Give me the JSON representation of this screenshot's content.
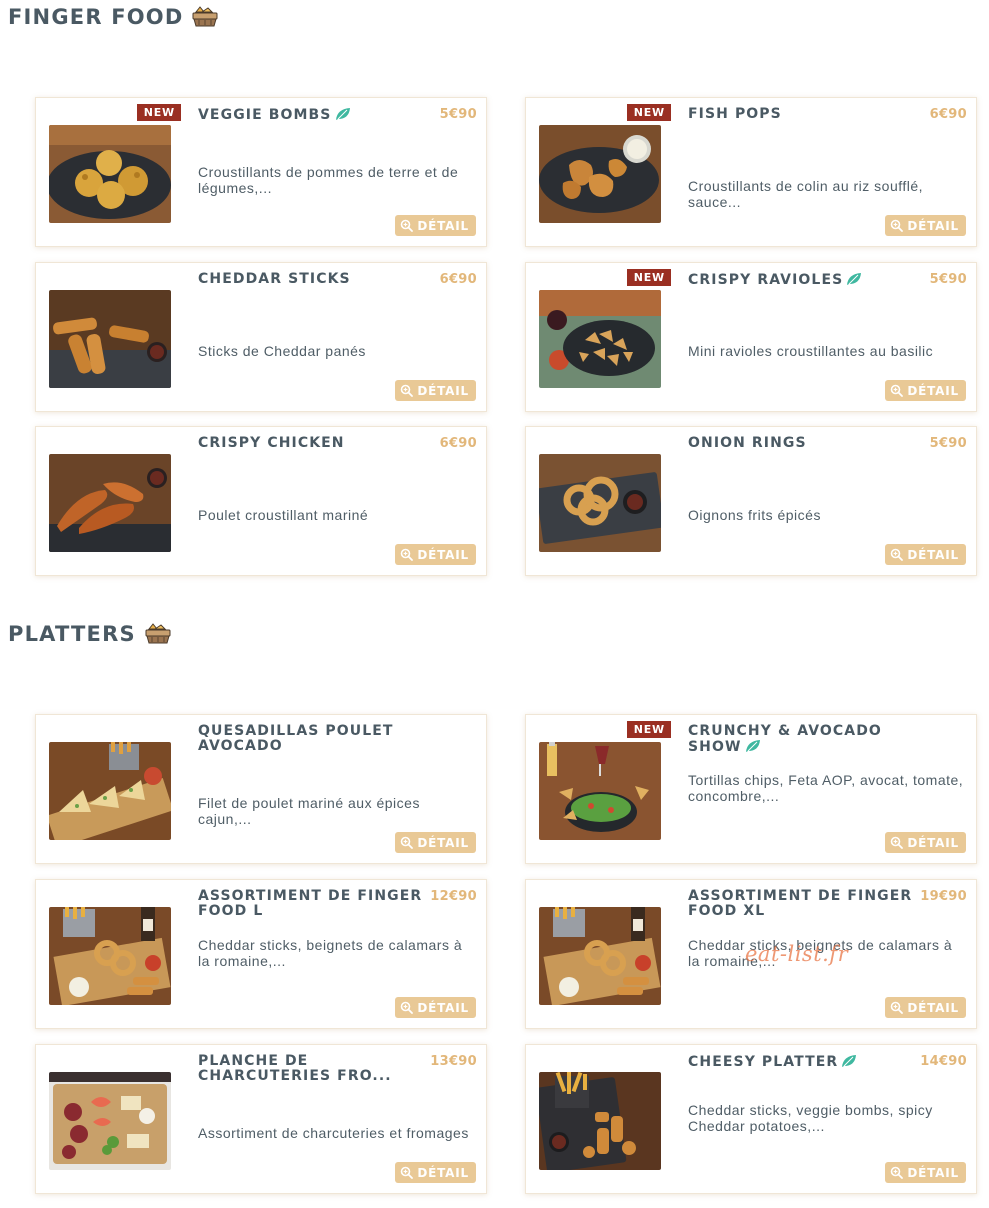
{
  "sections": {
    "finger_food": {
      "title": "FINGER FOOD",
      "icon": "food-basket-icon",
      "items": [
        {
          "name": "VEGGIE BOMBS",
          "price": "5€90",
          "desc": "Croustillants de pommes de terre et de légumes,...",
          "badge": "NEW",
          "vegetarian": true,
          "detail": "DÉTAIL",
          "photo": "veggie-bombs-photo"
        },
        {
          "name": "FISH POPS",
          "price": "6€90",
          "desc": "Croustillants de colin au riz soufflé, sauce...",
          "badge": "NEW",
          "vegetarian": false,
          "detail": "DÉTAIL",
          "photo": "fish-pops-photo"
        },
        {
          "name": "CHEDDAR STICKS",
          "price": "6€90",
          "desc": "Sticks de Cheddar panés",
          "badge": "",
          "vegetarian": false,
          "detail": "DÉTAIL",
          "photo": "cheddar-sticks-photo"
        },
        {
          "name": "CRISPY RAVIOLES",
          "price": "5€90",
          "desc": "Mini ravioles croustillantes au basilic",
          "badge": "NEW",
          "vegetarian": true,
          "detail": "DÉTAIL",
          "photo": "crispy-ravioles-photo"
        },
        {
          "name": "CRISPY CHICKEN",
          "price": "6€90",
          "desc": "Poulet croustillant mariné",
          "badge": "",
          "vegetarian": false,
          "detail": "DÉTAIL",
          "photo": "crispy-chicken-photo"
        },
        {
          "name": "ONION RINGS",
          "price": "5€90",
          "desc": "Oignons frits épicés",
          "badge": "",
          "vegetarian": false,
          "detail": "DÉTAIL",
          "photo": "onion-rings-photo"
        }
      ]
    },
    "platters": {
      "title": "PLATTERS",
      "icon": "food-basket-icon",
      "items": [
        {
          "name": "QUESADILLAS POULET AVOCADO",
          "price": "",
          "desc": "Filet de poulet mariné aux épices cajun,...",
          "badge": "",
          "vegetarian": false,
          "detail": "DÉTAIL",
          "photo": "quesadillas-photo"
        },
        {
          "name": "CRUNCHY & AVOCADO SHOW",
          "price": "",
          "desc": "Tortillas chips, Feta AOP, avocat, tomate, concombre,...",
          "badge": "NEW",
          "vegetarian": true,
          "detail": "DÉTAIL",
          "photo": "crunchy-avocado-photo"
        },
        {
          "name": "ASSORTIMENT DE FINGER FOOD L",
          "price": "12€90",
          "desc": "Cheddar sticks, beignets de calamars à la romaine,...",
          "badge": "",
          "vegetarian": false,
          "detail": "DÉTAIL",
          "photo": "finger-food-l-photo"
        },
        {
          "name": "ASSORTIMENT DE FINGER FOOD XL",
          "price": "19€90",
          "desc": "Cheddar sticks, beignets de calamars à la romaine,...",
          "badge": "",
          "vegetarian": false,
          "detail": "DÉTAIL",
          "photo": "finger-food-xl-photo"
        },
        {
          "name": "PLANCHE DE CHARCUTERIES FRO...",
          "price": "13€90",
          "desc": "Assortiment de charcuteries et fromages",
          "badge": "",
          "vegetarian": false,
          "detail": "DÉTAIL",
          "photo": "charcuterie-photo"
        },
        {
          "name": "CHEESY PLATTER",
          "price": "14€90",
          "desc": "Cheddar sticks, veggie bombs, spicy Cheddar potatoes,...",
          "badge": "",
          "vegetarian": true,
          "detail": "DÉTAIL",
          "photo": "cheesy-platter-photo"
        }
      ]
    }
  },
  "watermark": "eat-list.fr",
  "colors": {
    "title": "#4a5963",
    "price": "#e2b77a",
    "detail_button": "#e9c996",
    "new_badge": "#9a2f22",
    "leaf": "#3fb8a0"
  }
}
